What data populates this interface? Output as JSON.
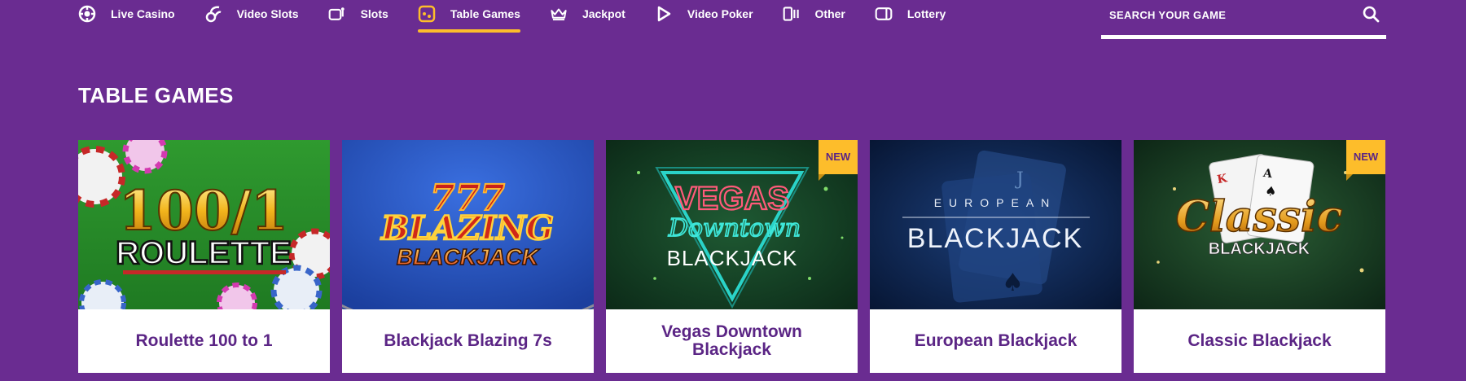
{
  "nav": {
    "items": [
      {
        "label": "Live Casino",
        "icon": "live-casino-icon"
      },
      {
        "label": "Video Slots",
        "icon": "video-slots-icon"
      },
      {
        "label": "Slots",
        "icon": "slots-icon"
      },
      {
        "label": "Table Games",
        "icon": "table-games-icon",
        "active": true
      },
      {
        "label": "Jackpot",
        "icon": "crown-icon"
      },
      {
        "label": "Video Poker",
        "icon": "play-icon"
      },
      {
        "label": "Other",
        "icon": "other-icon"
      },
      {
        "label": "Lottery",
        "icon": "lottery-icon"
      }
    ]
  },
  "search": {
    "placeholder": "SEARCH YOUR GAME",
    "icon": "search-icon"
  },
  "section": {
    "title": "TABLE GAMES"
  },
  "games": [
    {
      "name": "Roulette 100 to 1",
      "art_line1": "100/1",
      "art_line2": "ROULETTE",
      "badge": ""
    },
    {
      "name": "Blackjack Blazing 7s",
      "art_line1": "777",
      "art_line2": "BLAZING",
      "art_line3": "BLACKJACK",
      "badge": ""
    },
    {
      "name": "Vegas Downtown Blackjack",
      "art_line1": "VEGAS",
      "art_line2": "Downtown",
      "art_line3": "BLACKJACK",
      "badge": "NEW"
    },
    {
      "name": "European Blackjack",
      "art_line1": "EUROPEAN",
      "art_line2": "BLACKJACK",
      "badge": ""
    },
    {
      "name": "Classic Blackjack",
      "art_line1": "Classic",
      "art_line2": "BLACKJACK",
      "badge": "NEW"
    }
  ],
  "colors": {
    "background": "#6a2c91",
    "accent": "#fdbd2b",
    "card_text": "#5b2585"
  }
}
